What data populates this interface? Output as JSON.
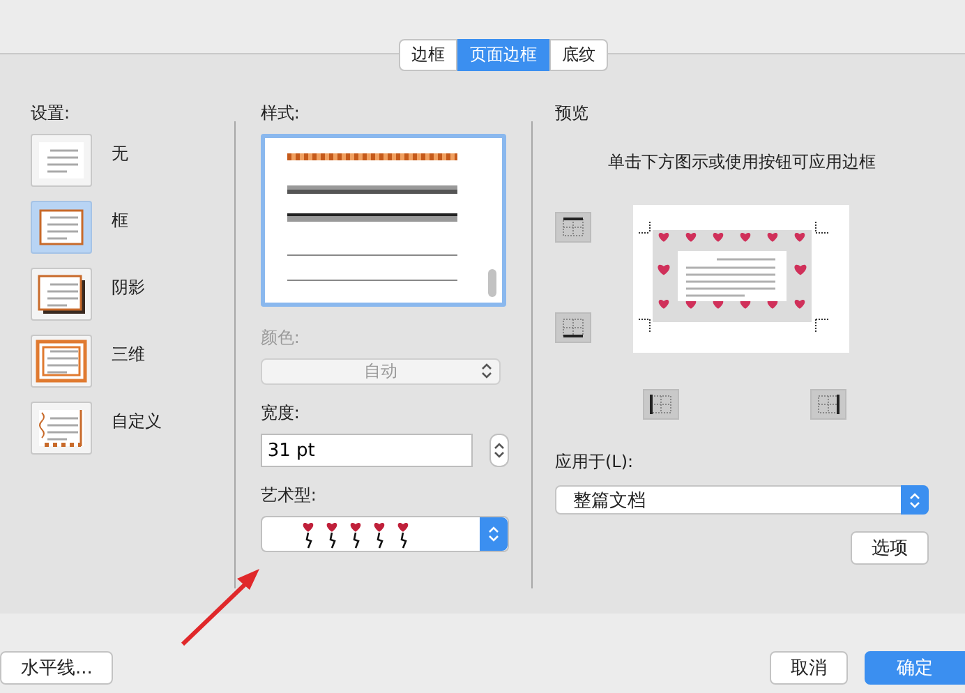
{
  "tabs": [
    {
      "label": "边框",
      "selected": false
    },
    {
      "label": "页面边框",
      "selected": true
    },
    {
      "label": "底纹",
      "selected": false
    }
  ],
  "settings": {
    "label": "设置:",
    "items": [
      {
        "kind": "none",
        "label": "无",
        "selected": false
      },
      {
        "kind": "box",
        "label": "框",
        "selected": true
      },
      {
        "kind": "shadow",
        "label": "阴影",
        "selected": false
      },
      {
        "kind": "threed",
        "label": "三维",
        "selected": false
      },
      {
        "kind": "custom",
        "label": "自定义",
        "selected": false
      }
    ]
  },
  "style": {
    "label": "样式:",
    "lines": [
      {
        "kind": "hatched"
      },
      {
        "kind": "thick"
      },
      {
        "kind": "double"
      },
      {
        "kind": "thin"
      },
      {
        "kind": "thin"
      }
    ]
  },
  "color": {
    "label": "颜色:",
    "value": "自动",
    "disabled": true
  },
  "width": {
    "label": "宽度:",
    "value": "31 pt"
  },
  "art": {
    "label": "艺术型:"
  },
  "preview": {
    "label": "预览",
    "instruction": "单击下方图示或使用按钮可应用边框"
  },
  "apply_to": {
    "label": "应用于(L):",
    "value": "整篇文档"
  },
  "options_button": "选项",
  "buttons": {
    "horizontal_line": "水平线...",
    "cancel": "取消",
    "ok": "确定"
  }
}
